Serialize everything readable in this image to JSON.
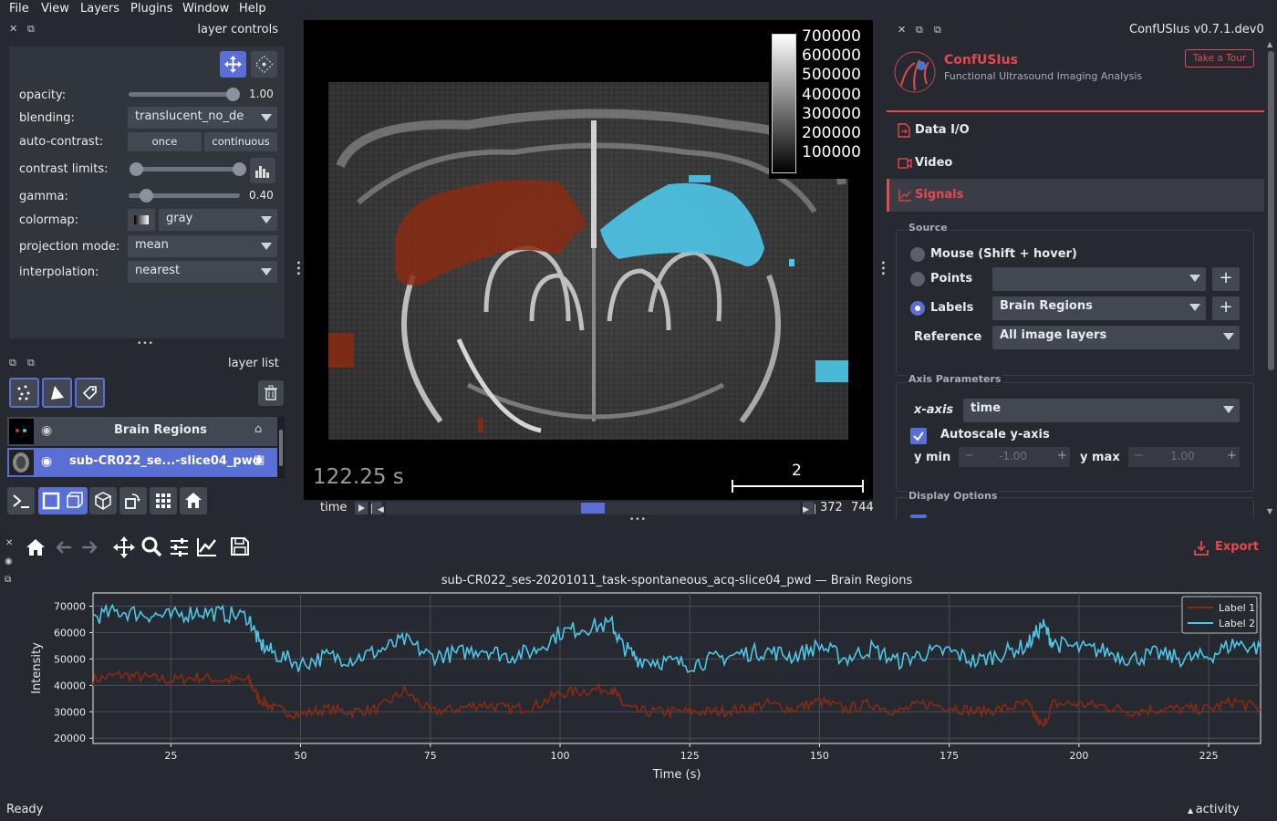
{
  "menu": [
    "File",
    "View",
    "Layers",
    "Plugins",
    "Window",
    "Help"
  ],
  "layer_controls": {
    "title": "layer controls",
    "opacity_label": "opacity:",
    "opacity_value": "1.00",
    "opacity": 1.0,
    "blending_label": "blending:",
    "blending_value": "translucent_no_de",
    "autocontrast_label": "auto-contrast:",
    "once": "once",
    "continuous": "continuous",
    "contrast_label": "contrast limits:",
    "gamma_label": "gamma:",
    "gamma_value": "0.40",
    "colormap_label": "colormap:",
    "colormap_value": "gray",
    "projection_label": "projection mode:",
    "projection_value": "mean",
    "interp_label": "interpolation:",
    "interp_value": "nearest",
    "more": "•••"
  },
  "layer_list": {
    "title": "layer list",
    "layers": [
      {
        "name": "Brain Regions",
        "selected": false
      },
      {
        "name": "sub-CR022_se...-slice04_pwd",
        "selected": true
      }
    ]
  },
  "canvas": {
    "timestamp": "122.25 s",
    "scale_label": "2",
    "colorbar_ticks": [
      "700000",
      "600000",
      "500000",
      "400000",
      "300000",
      "200000",
      "100000"
    ],
    "time_label": "time",
    "frame_current": "372",
    "frame_total": "744",
    "frame_fraction": 0.5,
    "more": "•••"
  },
  "plugin": {
    "header_title": "ConfUSIus v0.7.1.dev0",
    "name": "ConfUSIus",
    "subtitle": "Functional Ultrasound Imaging Analysis",
    "tour": "Take a Tour",
    "nav": [
      {
        "label": "Data I/O",
        "icon": "file-io-icon",
        "active": false
      },
      {
        "label": "Video",
        "icon": "video-icon",
        "active": false
      },
      {
        "label": "Signals",
        "icon": "signals-icon",
        "active": true
      }
    ],
    "source": {
      "title": "Source",
      "mouse": "Mouse (Shift + hover)",
      "points": "Points",
      "points_value": "",
      "labels": "Labels",
      "labels_value": "Brain Regions",
      "reference": "Reference",
      "reference_value": "All image layers"
    },
    "axis": {
      "title": "Axis Parameters",
      "xaxis": "x-axis",
      "xaxis_value": "time",
      "autoscale": "Autoscale y-axis",
      "ymin": "y min",
      "ymin_value": "-1.00",
      "ymax": "y max",
      "ymax_value": "1.00",
      "minus": "−",
      "plus": "+"
    },
    "display": {
      "title": "Display Options"
    },
    "accent": "#e5484d"
  },
  "plot": {
    "export": "Export",
    "more": "•••",
    "status": "Ready",
    "activity": "activity"
  },
  "chart_data": {
    "type": "line",
    "title": "sub-CR022_ses-20201011_task-spontaneous_acq-slice04_pwd — Brain Regions",
    "xlabel": "Time (s)",
    "ylabel": "Intensity",
    "xlim": [
      10,
      235
    ],
    "ylim": [
      18000,
      75000
    ],
    "xticks": [
      25,
      50,
      75,
      100,
      125,
      150,
      175,
      200,
      225
    ],
    "yticks": [
      20000,
      30000,
      40000,
      50000,
      60000,
      70000
    ],
    "ytick_labels": [
      "20000",
      "30000",
      "40000",
      "50000",
      "60000",
      "70000"
    ],
    "grid": true,
    "legend": "top-right",
    "series": [
      {
        "name": "Label 1",
        "color": "#8a2a12",
        "x": [
          10,
          15,
          20,
          25,
          30,
          35,
          40,
          42,
          45,
          50,
          55,
          60,
          65,
          70,
          75,
          80,
          85,
          90,
          95,
          100,
          105,
          110,
          112,
          115,
          120,
          125,
          130,
          135,
          140,
          145,
          150,
          155,
          160,
          165,
          170,
          175,
          180,
          185,
          190,
          193,
          195,
          200,
          205,
          210,
          215,
          220,
          225,
          230,
          235
        ],
        "y": [
          42000,
          44000,
          43000,
          42000,
          43000,
          42000,
          42000,
          35000,
          31000,
          29000,
          31000,
          30000,
          31000,
          38000,
          30000,
          31000,
          33000,
          31000,
          32000,
          37000,
          38000,
          39000,
          33000,
          30000,
          30000,
          30000,
          30000,
          31000,
          33000,
          31000,
          34000,
          31000,
          33000,
          30000,
          33000,
          32000,
          30000,
          31000,
          33000,
          24000,
          33000,
          33000,
          32000,
          30000,
          31000,
          31000,
          31000,
          34000,
          31000
        ]
      },
      {
        "name": "Label 2",
        "color": "#4dc6e8",
        "x": [
          10,
          15,
          20,
          25,
          30,
          35,
          40,
          42,
          45,
          50,
          55,
          60,
          65,
          70,
          75,
          80,
          85,
          90,
          95,
          100,
          105,
          110,
          112,
          115,
          120,
          125,
          130,
          135,
          140,
          145,
          150,
          155,
          160,
          165,
          170,
          175,
          180,
          185,
          190,
          193,
          195,
          200,
          205,
          210,
          215,
          220,
          225,
          230,
          235
        ],
        "y": [
          66000,
          68000,
          67000,
          66000,
          68000,
          67000,
          66000,
          56000,
          52000,
          48000,
          51000,
          50000,
          53000,
          57000,
          51000,
          52000,
          54000,
          51000,
          53000,
          60000,
          62000,
          63000,
          55000,
          50000,
          49000,
          48000,
          50000,
          52000,
          53000,
          51000,
          55000,
          50000,
          54000,
          49000,
          52000,
          53000,
          49000,
          52000,
          55000,
          63000,
          56000,
          54000,
          53000,
          50000,
          52000,
          50000,
          51000,
          56000,
          54000
        ]
      }
    ]
  }
}
